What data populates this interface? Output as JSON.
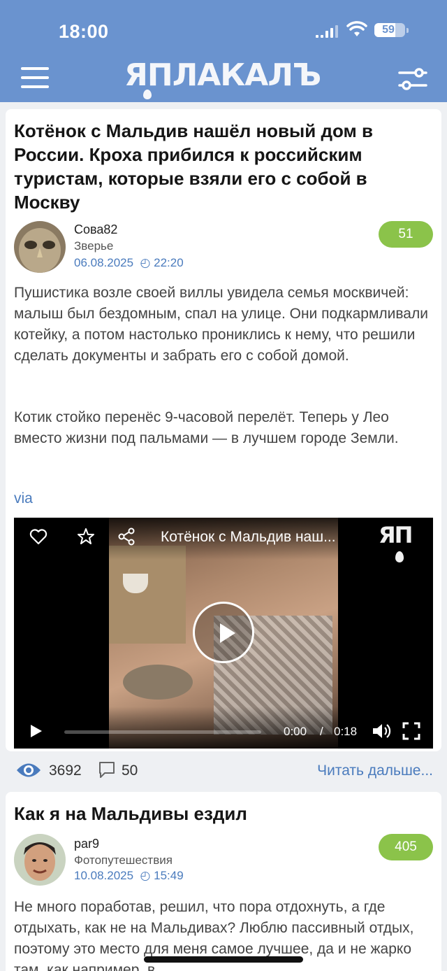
{
  "status_bar": {
    "time": "18:00",
    "battery": "59"
  },
  "header": {
    "logo": "ЯПЛАКАЛЪ"
  },
  "posts": [
    {
      "title": "Котёнок с Мальдив нашёл новый дом в России. Кроха прибился к российским туристам, которые взяли его с собой в Москву",
      "author": "Сова82",
      "category": "Зверье",
      "date": "06.08.2025",
      "time": "22:20",
      "rating": "51",
      "paragraphs": [
        "Пушистика возле своей виллы увидела семья москвичей: малыш был бездомным, спал на улице. Они подкармливали котейку, а потом настолько прониклись к нему, что решили сделать документы и забрать его с собой домой.",
        "Котик стойко перенёс 9-часовой перелёт. Теперь у Лео вместо жизни под пальмами — в лучшем городе Земли."
      ],
      "via": "via",
      "video": {
        "title": "Котёнок с Мальдив наш...",
        "logo": "ЯП",
        "current_time": "0:00",
        "separator": "/",
        "duration": "0:18",
        "progress": 0
      },
      "views": "3692",
      "comments": "50",
      "read_more": "Читать дальше..."
    },
    {
      "title": "Как я на Мальдивы ездил",
      "author": "par9",
      "category": "Фотопутешествия",
      "date": "10.08.2025",
      "time": "15:49",
      "rating": "405",
      "paragraph": "Не много поработав, решил, что пора отдохнуть, а где отдыхать, как не на Мальдивах? Люблю пассивный отдых, поэтому это место для меня самое лучшее, да и не жарко там, как например, в"
    }
  ],
  "colors": {
    "header": "#6a93cf",
    "rating": "#8bc34a",
    "link": "#4a7bbd"
  }
}
